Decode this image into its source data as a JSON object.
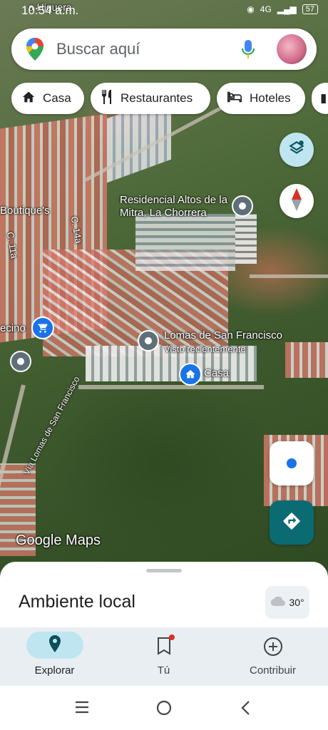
{
  "status_bar": {
    "time": "10:54 a.m.",
    "network": "4G",
    "battery": "57"
  },
  "search": {
    "placeholder": "Buscar aquí"
  },
  "chips": [
    {
      "label": "Casa",
      "icon": "home-icon"
    },
    {
      "label": "Restaurantes",
      "icon": "restaurant-icon"
    },
    {
      "label": "Hoteles",
      "icon": "hotel-icon"
    }
  ],
  "map_labels": {
    "residencial": "Residencial Altos de la Mitra, La Chorrera",
    "lomas": "Lomas de San Francisco",
    "lomas_sub": "Visto recientemente",
    "casa": "Casa",
    "boutique": "Boutique's",
    "vecino": "ecino",
    "street_c14a": "C. 14a",
    "street_c11a": "C. 11a",
    "via_lomas": "Vía Lomas de San Francisco",
    "watermark": "Google Maps",
    "edge_label": "a Higuera"
  },
  "bottom_sheet": {
    "title": "Ambiente local",
    "weather_temp": "30°"
  },
  "nav": {
    "explore": "Explorar",
    "you": "Tú",
    "contribute": "Contribuir"
  },
  "colors": {
    "accent": "#0b6b73",
    "nav_active_bg": "#bfe6f0",
    "pin": "#5f6f7a",
    "badge": "#d93025"
  }
}
